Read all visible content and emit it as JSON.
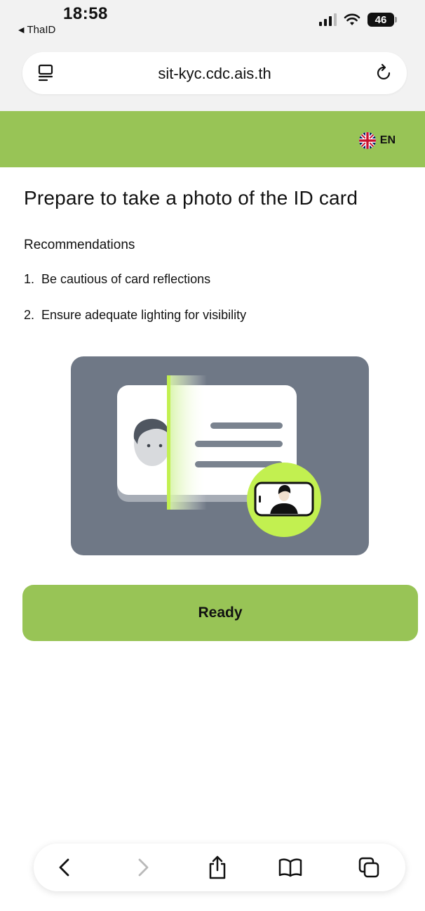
{
  "status_bar": {
    "time": "18:58",
    "back_app": "ThaID",
    "back_arrow": "◀",
    "battery": "46",
    "icons": [
      "signal-icon",
      "wifi-icon",
      "battery-icon"
    ]
  },
  "browser": {
    "url": "sit-kyc.cdc.ais.th",
    "icons": [
      "reader-icon",
      "reload-icon"
    ]
  },
  "header": {
    "language": "EN",
    "flag_icon": "uk-flag-icon",
    "accent_color": "#98c456"
  },
  "main": {
    "title": "Prepare to take a photo of the ID card",
    "recommendations_heading": "Recommendations",
    "recommendations": [
      {
        "number": "1.",
        "text": "Be cautious of card reflections"
      },
      {
        "number": "2.",
        "text": "Ensure adequate lighting for visibility"
      }
    ],
    "illustration_icon": "id-card-scan-illustration",
    "ready_label": "Ready"
  },
  "toolbar": {
    "icons": [
      "back-icon",
      "forward-icon",
      "share-icon",
      "bookmarks-icon",
      "tabs-icon"
    ]
  }
}
